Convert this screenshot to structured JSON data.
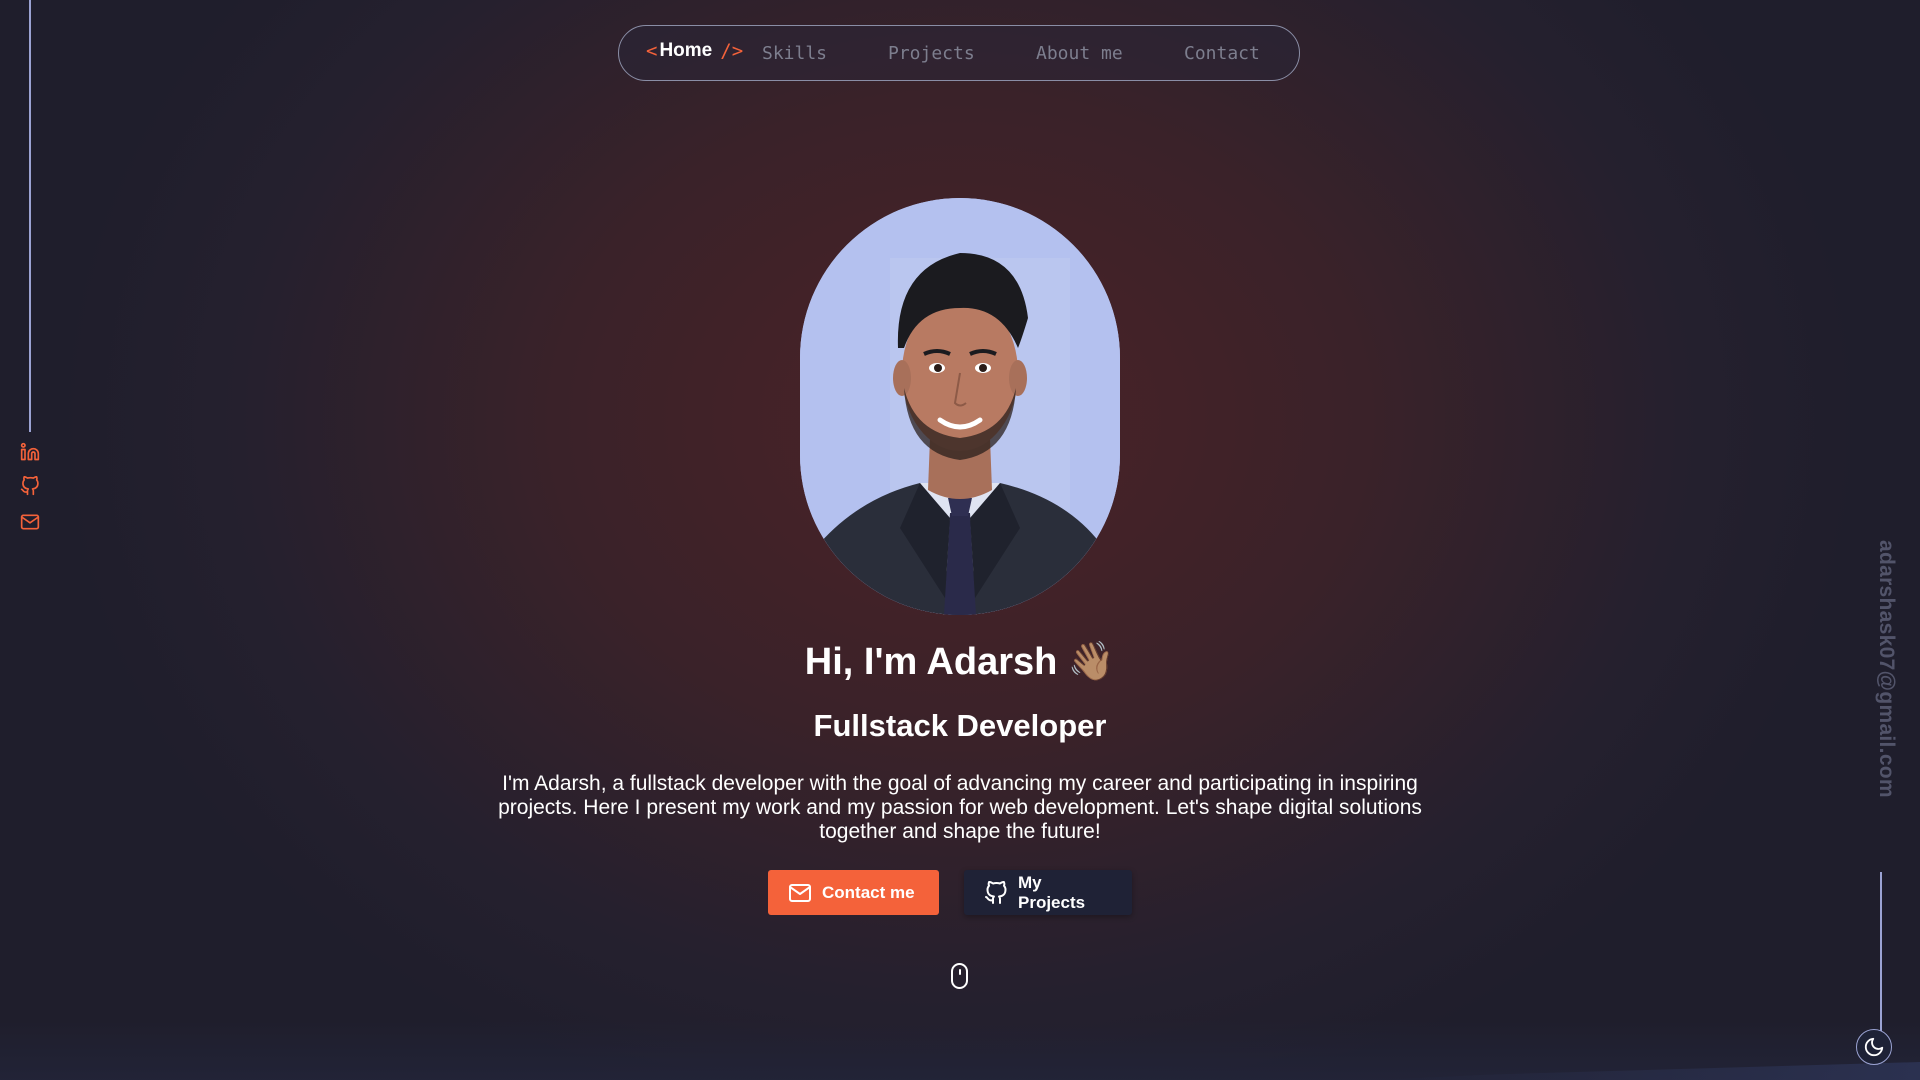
{
  "nav": {
    "home_open": "<",
    "home_label": "Home",
    "home_close": "/>",
    "items": [
      "Skills",
      "Projects",
      "About me",
      "Contact"
    ]
  },
  "social": {
    "icons": [
      "linkedin-icon",
      "github-icon",
      "mail-icon"
    ]
  },
  "sidebar_email": "adarshask07@gmail.com",
  "hero": {
    "greeting": "Hi, I'm Adarsh",
    "wave": "👋🏽",
    "role": "Fullstack Developer",
    "description": "I'm Adarsh, a fullstack developer with the goal of advancing my career and participating in inspiring projects. Here I present my work and my passion for web development. Let's shape digital solutions together and shape the future!"
  },
  "buttons": {
    "contact_label": "Contact me",
    "projects_label": "My Projects"
  },
  "colors": {
    "accent": "#f4623a",
    "line": "#9ba3d3",
    "avatar_bg": "#b2c0ef"
  }
}
